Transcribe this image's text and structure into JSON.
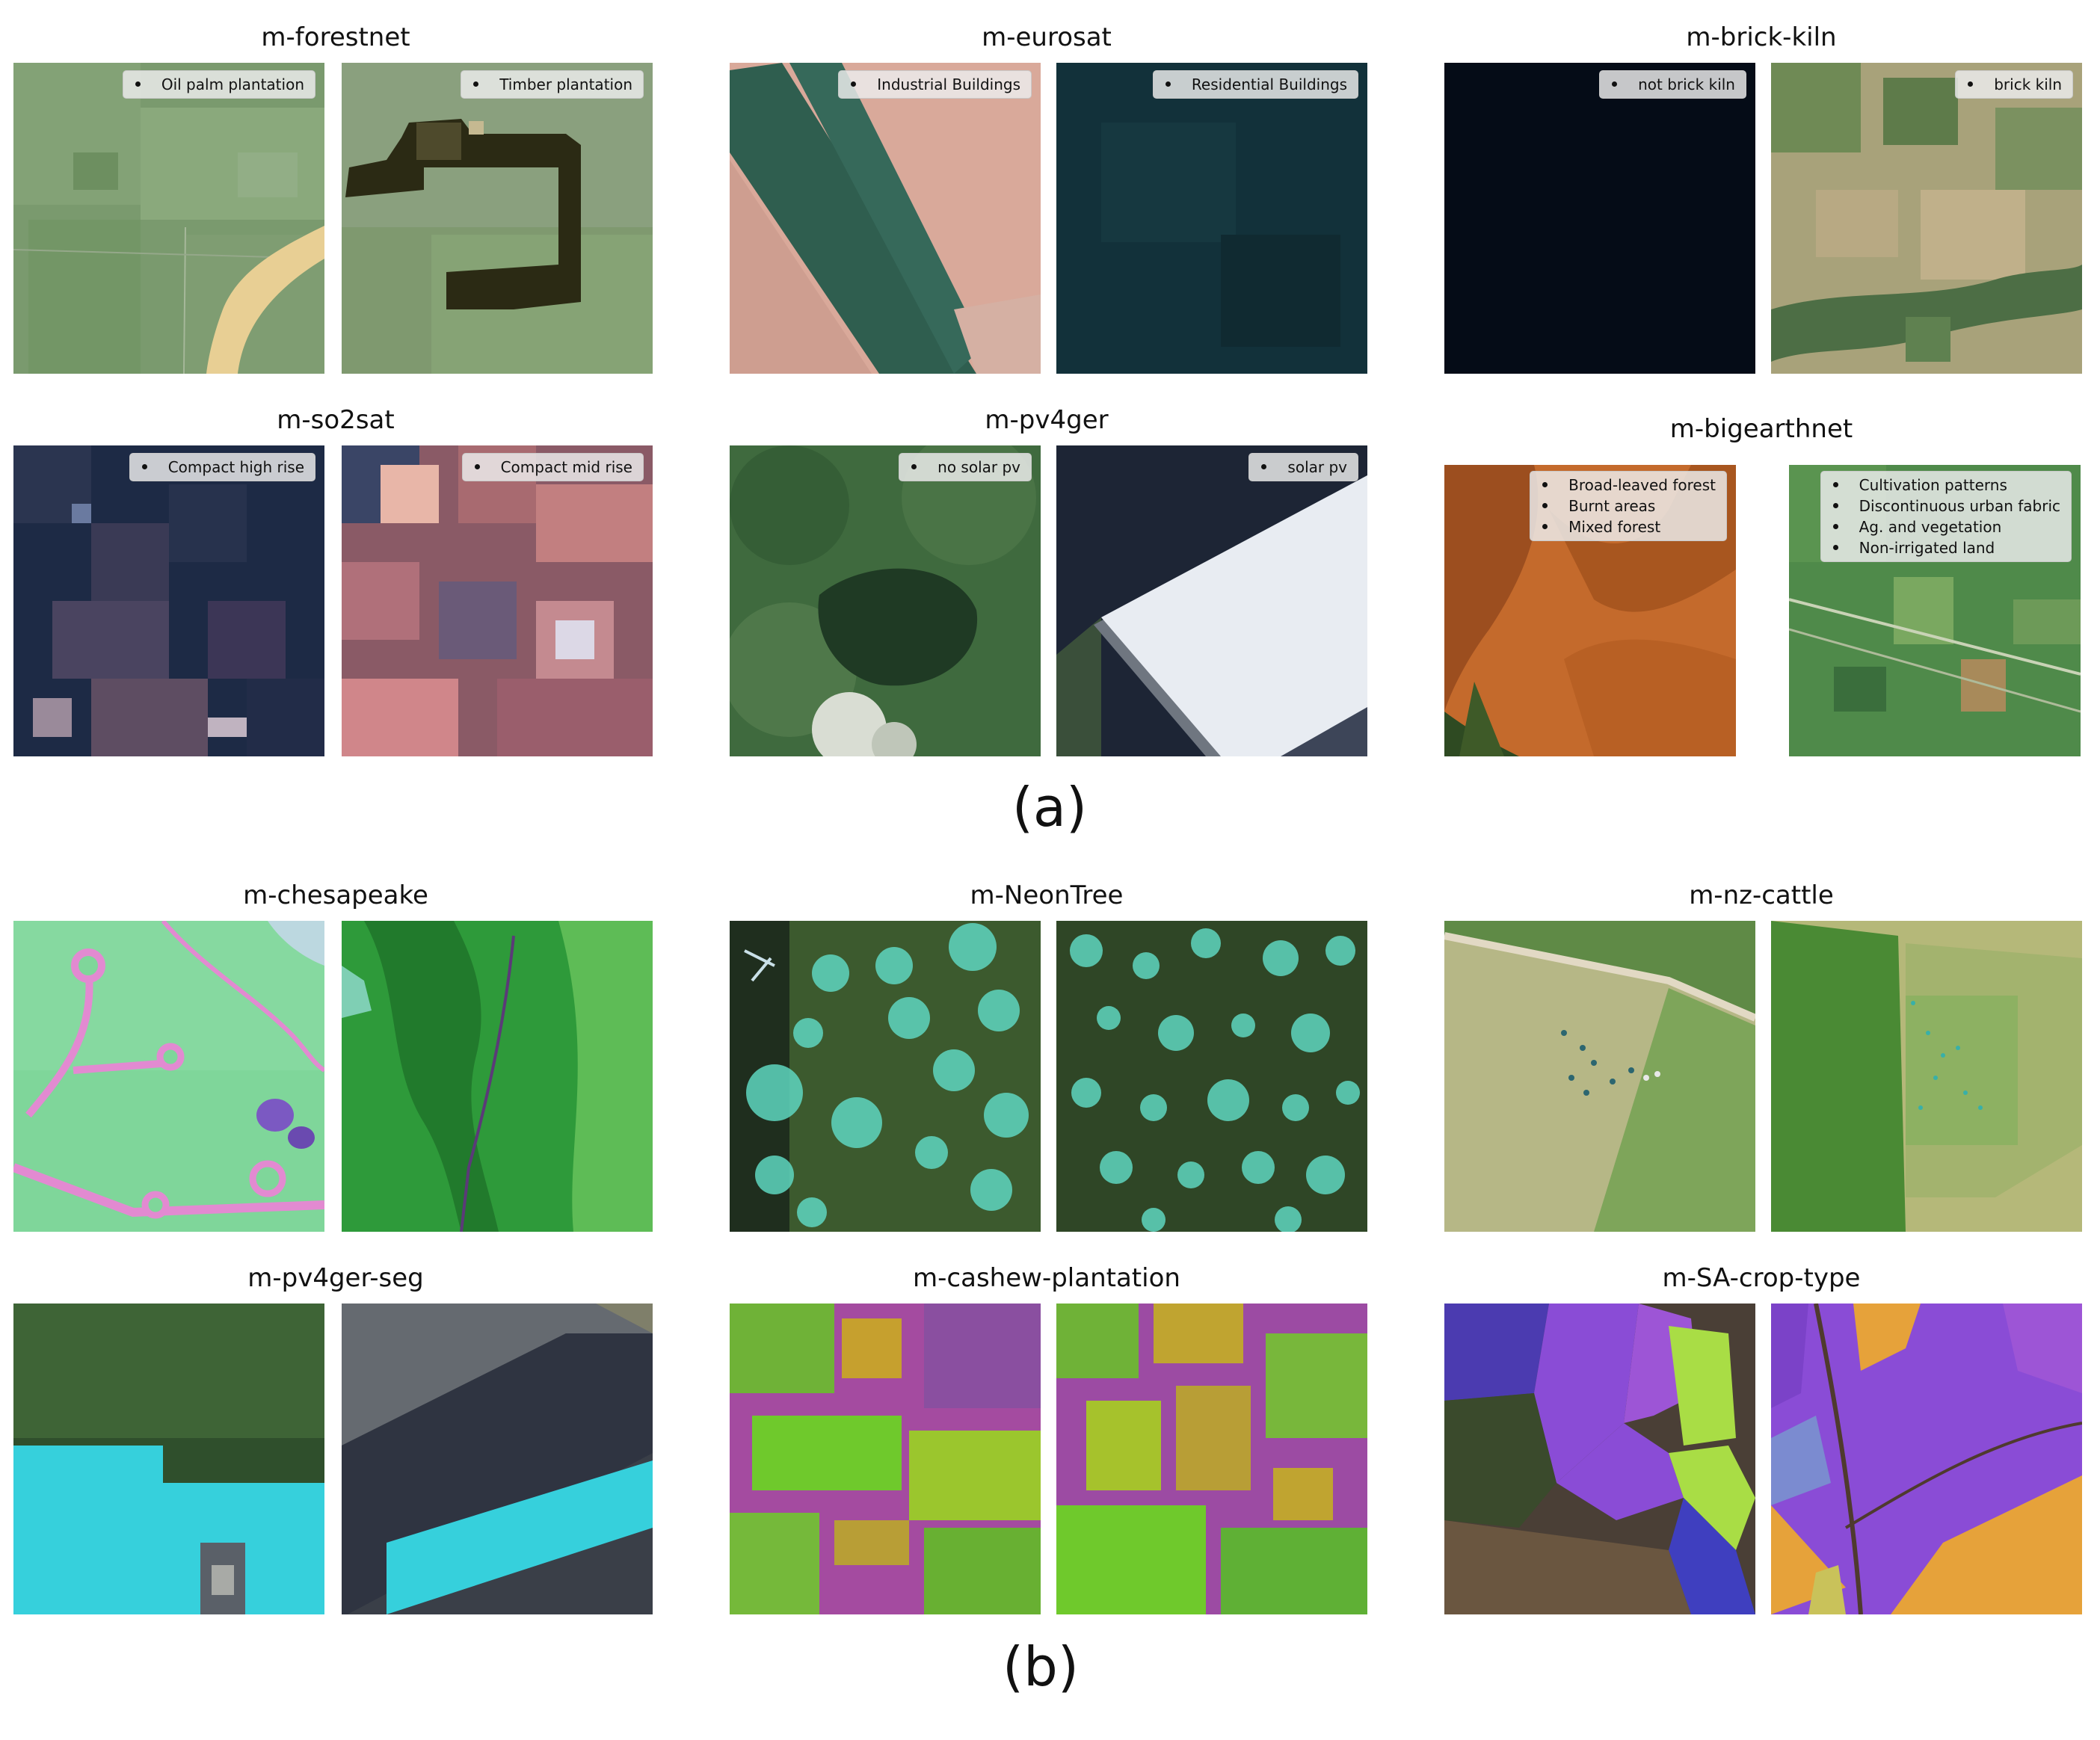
{
  "panels": {
    "a": {
      "label": "(a)"
    },
    "b": {
      "label": "(b)"
    }
  },
  "datasets": {
    "forestnet": {
      "title": "m-forestnet",
      "tiles": [
        {
          "legend": [
            "Oil palm plantation"
          ]
        },
        {
          "legend": [
            "Timber plantation"
          ]
        }
      ]
    },
    "eurosat": {
      "title": "m-eurosat",
      "tiles": [
        {
          "legend": [
            "Industrial Buildings"
          ]
        },
        {
          "legend": [
            "Residential Buildings"
          ]
        }
      ]
    },
    "brick_kiln": {
      "title": "m-brick-kiln",
      "tiles": [
        {
          "legend": [
            "not brick kiln"
          ]
        },
        {
          "legend": [
            "brick kiln"
          ]
        }
      ]
    },
    "so2sat": {
      "title": "m-so2sat",
      "tiles": [
        {
          "legend": [
            "Compact high rise"
          ]
        },
        {
          "legend": [
            "Compact mid rise"
          ]
        }
      ]
    },
    "pv4ger": {
      "title": "m-pv4ger",
      "tiles": [
        {
          "legend": [
            "no solar pv"
          ]
        },
        {
          "legend": [
            "solar pv"
          ]
        }
      ]
    },
    "bigearthnet": {
      "title": "m-bigearthnet",
      "tiles": [
        {
          "legend": [
            "Broad-leaved forest",
            "Burnt areas",
            "Mixed forest"
          ]
        },
        {
          "legend": [
            "Cultivation patterns",
            "Discontinuous urban fabric",
            "Ag. and vegetation",
            "Non-irrigated land"
          ]
        }
      ]
    },
    "chesapeake": {
      "title": "m-chesapeake"
    },
    "neontree": {
      "title": "m-NeonTree"
    },
    "nz_cattle": {
      "title": "m-nz-cattle"
    },
    "pv4ger_seg": {
      "title": "m-pv4ger-seg"
    },
    "cashew": {
      "title": "m-cashew-plantation"
    },
    "sa_crop": {
      "title": "m-SA-crop-type"
    }
  },
  "colors": {
    "legend_bg": "#ececec",
    "segmentation_pink": "#e48ad0",
    "tree_overlay": "#5ed6c0",
    "solar_overlay": "#3fd6e6",
    "crop_purple": "#8a4cd6",
    "crop_orange": "#e6a23a"
  }
}
